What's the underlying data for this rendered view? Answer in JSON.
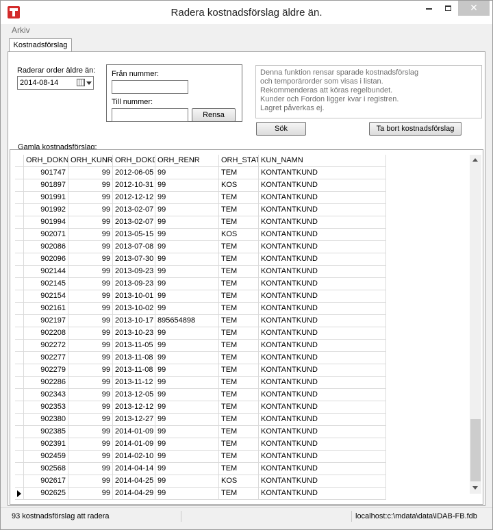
{
  "window": {
    "title": "Radera kostnadsförslag äldre än.",
    "close_glyph": "✕"
  },
  "menu": {
    "arkiv": "Arkiv"
  },
  "tabs": [
    {
      "label": "Kostnadsförslag"
    }
  ],
  "filter": {
    "older_than_label": "Raderar order äldre än:",
    "date_value": "2014-08-14",
    "from_label": "Från nummer:",
    "from_value": "",
    "to_label": "Till nummer:",
    "to_value": "",
    "clear_button": "Rensa"
  },
  "info": {
    "lines": [
      "Denna funktion rensar sparade kostnadsförslag",
      "och temporärorder som visas i listan.",
      "Rekommenderas att köras regelbundet.",
      "Kunder och Fordon ligger kvar i registren.",
      "Lagret påverkas ej."
    ],
    "search_button": "Sök",
    "delete_button": "Ta bort kostnadsförslag"
  },
  "grid": {
    "caption": "Gamla kostnadsförslag:",
    "columns": [
      "ORH_DOKN",
      "ORH_KUNR",
      "ORH_DOKD",
      "ORH_RENR",
      "ORH_STAT",
      "KUN_NAMN"
    ],
    "rows": [
      [
        "901747",
        "99",
        "2012-06-05",
        "99",
        "TEM",
        "KONTANTKUND"
      ],
      [
        "901897",
        "99",
        "2012-10-31",
        "99",
        "KOS",
        "KONTANTKUND"
      ],
      [
        "901991",
        "99",
        "2012-12-12",
        "99",
        "TEM",
        "KONTANTKUND"
      ],
      [
        "901992",
        "99",
        "2013-02-07",
        "99",
        "TEM",
        "KONTANTKUND"
      ],
      [
        "901994",
        "99",
        "2013-02-07",
        "99",
        "TEM",
        "KONTANTKUND"
      ],
      [
        "902071",
        "99",
        "2013-05-15",
        "99",
        "KOS",
        "KONTANTKUND"
      ],
      [
        "902086",
        "99",
        "2013-07-08",
        "99",
        "TEM",
        "KONTANTKUND"
      ],
      [
        "902096",
        "99",
        "2013-07-30",
        "99",
        "TEM",
        "KONTANTKUND"
      ],
      [
        "902144",
        "99",
        "2013-09-23",
        "99",
        "TEM",
        "KONTANTKUND"
      ],
      [
        "902145",
        "99",
        "2013-09-23",
        "99",
        "TEM",
        "KONTANTKUND"
      ],
      [
        "902154",
        "99",
        "2013-10-01",
        "99",
        "TEM",
        "KONTANTKUND"
      ],
      [
        "902161",
        "99",
        "2013-10-02",
        "99",
        "TEM",
        "KONTANTKUND"
      ],
      [
        "902197",
        "99",
        "2013-10-17",
        "895654898",
        "TEM",
        "KONTANTKUND"
      ],
      [
        "902208",
        "99",
        "2013-10-23",
        "99",
        "TEM",
        "KONTANTKUND"
      ],
      [
        "902272",
        "99",
        "2013-11-05",
        "99",
        "TEM",
        "KONTANTKUND"
      ],
      [
        "902277",
        "99",
        "2013-11-08",
        "99",
        "TEM",
        "KONTANTKUND"
      ],
      [
        "902279",
        "99",
        "2013-11-08",
        "99",
        "TEM",
        "KONTANTKUND"
      ],
      [
        "902286",
        "99",
        "2013-11-12",
        "99",
        "TEM",
        "KONTANTKUND"
      ],
      [
        "902343",
        "99",
        "2013-12-05",
        "99",
        "TEM",
        "KONTANTKUND"
      ],
      [
        "902353",
        "99",
        "2013-12-12",
        "99",
        "TEM",
        "KONTANTKUND"
      ],
      [
        "902380",
        "99",
        "2013-12-27",
        "99",
        "TEM",
        "KONTANTKUND"
      ],
      [
        "902385",
        "99",
        "2014-01-09",
        "99",
        "TEM",
        "KONTANTKUND"
      ],
      [
        "902391",
        "99",
        "2014-01-09",
        "99",
        "TEM",
        "KONTANTKUND"
      ],
      [
        "902459",
        "99",
        "2014-02-10",
        "99",
        "TEM",
        "KONTANTKUND"
      ],
      [
        "902568",
        "99",
        "2014-04-14",
        "99",
        "TEM",
        "KONTANTKUND"
      ],
      [
        "902617",
        "99",
        "2014-04-25",
        "99",
        "KOS",
        "KONTANTKUND"
      ],
      [
        "902625",
        "99",
        "2014-04-29",
        "99",
        "TEM",
        "KONTANTKUND"
      ]
    ],
    "current_row": 26
  },
  "status": {
    "count_text": "93 kostnadsförslag att radera",
    "connection": "localhost:c:\\mdata\\data\\IDAB-FB.fdb"
  }
}
